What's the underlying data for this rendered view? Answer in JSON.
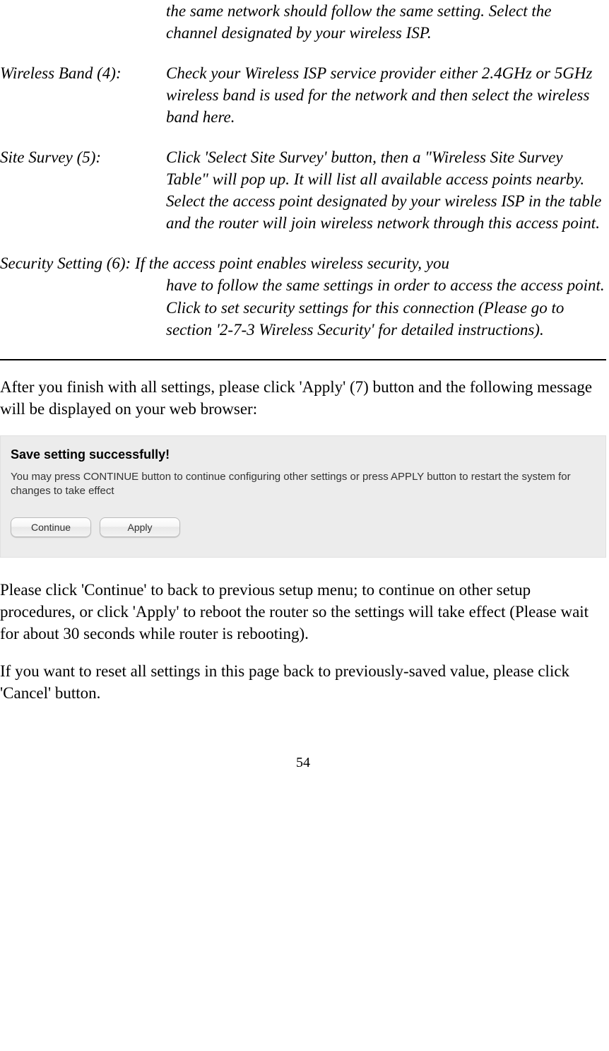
{
  "definitions": {
    "item3_cont": "the same network should follow the same setting. Select the channel designated by your wireless ISP.",
    "item4": {
      "label": "Wireless Band (4):",
      "value": "Check your Wireless ISP service provider either 2.4GHz or 5GHz wireless band is used for the network and then select the wireless band here."
    },
    "item5": {
      "label": "Site Survey (5):",
      "value": "Click 'Select Site Survey' button, then a \"Wireless Site Survey Table\" will pop up. It will list all available access points nearby. Select the access point designated by your wireless ISP in the table and the router will join wireless network through this access point."
    },
    "item6": {
      "label": "Security Setting (6): ",
      "first_line_value": "If the access point enables wireless security, you",
      "cont": "have to follow the same settings in order to access the access point. Click to set security settings for this connection   (Please go to section '2-7-3 Wireless Security' for detailed instructions)."
    }
  },
  "body": {
    "after_apply": "After you finish with all settings, please click 'Apply' (7) button and the following message will be displayed on your web browser:",
    "continue_text": "Please click 'Continue' to back to previous setup menu; to continue on other setup procedures, or click 'Apply' to reboot the router so the settings will take effect (Please wait for about 30 seconds while router is rebooting).",
    "reset_text": "If you want to reset all settings in this page back to previously-saved value, please click 'Cancel' button."
  },
  "panel": {
    "title": "Save setting successfully!",
    "desc": "You may press CONTINUE button to continue configuring other settings or press APPLY button to restart the system for changes to take effect",
    "continue_label": "Continue",
    "apply_label": "Apply"
  },
  "page_number": "54"
}
